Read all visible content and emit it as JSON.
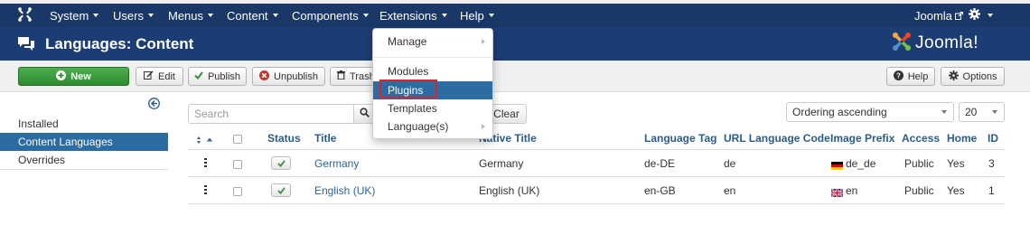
{
  "topnav": {
    "menus": [
      "System",
      "Users",
      "Menus",
      "Content",
      "Components",
      "Extensions",
      "Help"
    ],
    "user_label": "Joomla",
    "gear_icon": "gear-icon",
    "logo_icon": "joomla-logo-icon"
  },
  "header": {
    "title": "Languages: Content",
    "brand": "Joomla!",
    "title_icon": "comments-icon"
  },
  "toolbar": {
    "new_label": "New",
    "edit_label": "Edit",
    "publish_label": "Publish",
    "unpublish_label": "Unpublish",
    "trash_label": "Trash",
    "help_label": "Help",
    "options_label": "Options"
  },
  "sidebar": {
    "items": [
      {
        "label": "Installed",
        "active": false
      },
      {
        "label": "Content Languages",
        "active": true
      },
      {
        "label": "Overrides",
        "active": false
      }
    ]
  },
  "filters": {
    "search_placeholder": "Search",
    "clear_label": "Clear",
    "ordering": "Ordering ascending",
    "limit": "20"
  },
  "table": {
    "headers": {
      "status": "Status",
      "title": "Title",
      "native_title": "Native Title",
      "language_tag": "Language Tag",
      "url_code": "URL Language Code",
      "image_prefix": "Image Prefix",
      "access": "Access",
      "home": "Home",
      "id": "ID"
    },
    "rows": [
      {
        "title": "Germany",
        "native_title": "Germany",
        "language_tag": "de-DE",
        "url_code": "de",
        "image_prefix": "de_de",
        "access": "Public",
        "home": "Yes",
        "id": "3"
      },
      {
        "title": "English (UK)",
        "native_title": "English (UK)",
        "language_tag": "en-GB",
        "url_code": "en",
        "image_prefix": "en",
        "access": "Public",
        "home": "Yes",
        "id": "1"
      }
    ]
  },
  "dropdown": {
    "items": [
      "Manage",
      "Modules",
      "Plugins",
      "Templates",
      "Language(s)"
    ],
    "highlighted": "Plugins"
  },
  "colors": {
    "navbar": "#1a3867",
    "header": "#1c3d74",
    "accent": "#2d6ca2",
    "new_button": "#3c9a3c",
    "highlight_box": "#d9232e"
  }
}
